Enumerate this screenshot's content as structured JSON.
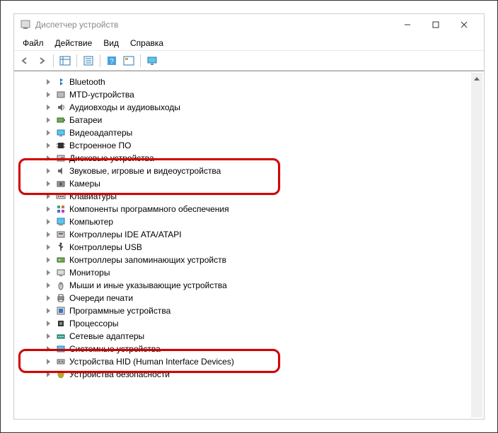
{
  "window": {
    "title": "Диспетчер устройств"
  },
  "menu": {
    "file": "Файл",
    "action": "Действие",
    "view": "Вид",
    "help": "Справка"
  },
  "tree": {
    "items": [
      {
        "label": "Bluetooth",
        "icon": "bluetooth"
      },
      {
        "label": "MTD-устройства",
        "icon": "device"
      },
      {
        "label": "Аудиовходы и аудиовыходы",
        "icon": "audio"
      },
      {
        "label": "Батареи",
        "icon": "battery"
      },
      {
        "label": "Видеоадаптеры",
        "icon": "display"
      },
      {
        "label": "Встроенное ПО",
        "icon": "chip"
      },
      {
        "label": "Дисковые устройства",
        "icon": "disk"
      },
      {
        "label": "Звуковые, игровые и видеоустройства",
        "icon": "sound"
      },
      {
        "label": "Камеры",
        "icon": "camera"
      },
      {
        "label": "Клавиатуры",
        "icon": "keyboard"
      },
      {
        "label": "Компоненты программного обеспечения",
        "icon": "component"
      },
      {
        "label": "Компьютер",
        "icon": "computer"
      },
      {
        "label": "Контроллеры IDE ATA/ATAPI",
        "icon": "ide"
      },
      {
        "label": "Контроллеры USB",
        "icon": "usb"
      },
      {
        "label": "Контроллеры запоминающих устройств",
        "icon": "storage"
      },
      {
        "label": "Мониторы",
        "icon": "monitor"
      },
      {
        "label": "Мыши и иные указывающие устройства",
        "icon": "mouse"
      },
      {
        "label": "Очереди печати",
        "icon": "printer"
      },
      {
        "label": "Программные устройства",
        "icon": "software"
      },
      {
        "label": "Процессоры",
        "icon": "cpu"
      },
      {
        "label": "Сетевые адаптеры",
        "icon": "network"
      },
      {
        "label": "Системные устройства",
        "icon": "system"
      },
      {
        "label": "Устройства HID (Human Interface Devices)",
        "icon": "hid"
      },
      {
        "label": "Устройства безопасности",
        "icon": "security"
      }
    ]
  }
}
